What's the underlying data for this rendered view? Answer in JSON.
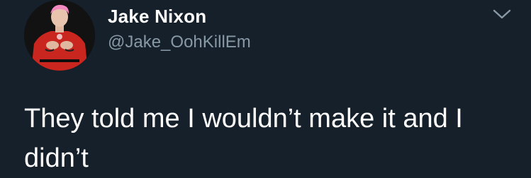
{
  "tweet": {
    "author": {
      "display_name": "Jake Nixon",
      "handle": "@Jake_OohKillEm",
      "avatar_icon": "profile-photo"
    },
    "text": "They told me I wouldn’t make it and I didn’t",
    "menu_icon": "chevron-down-icon"
  },
  "colors": {
    "background": "#15202b",
    "primary_text": "#ffffff",
    "secondary_text": "#8899a6",
    "chevron": "#8899a6"
  }
}
